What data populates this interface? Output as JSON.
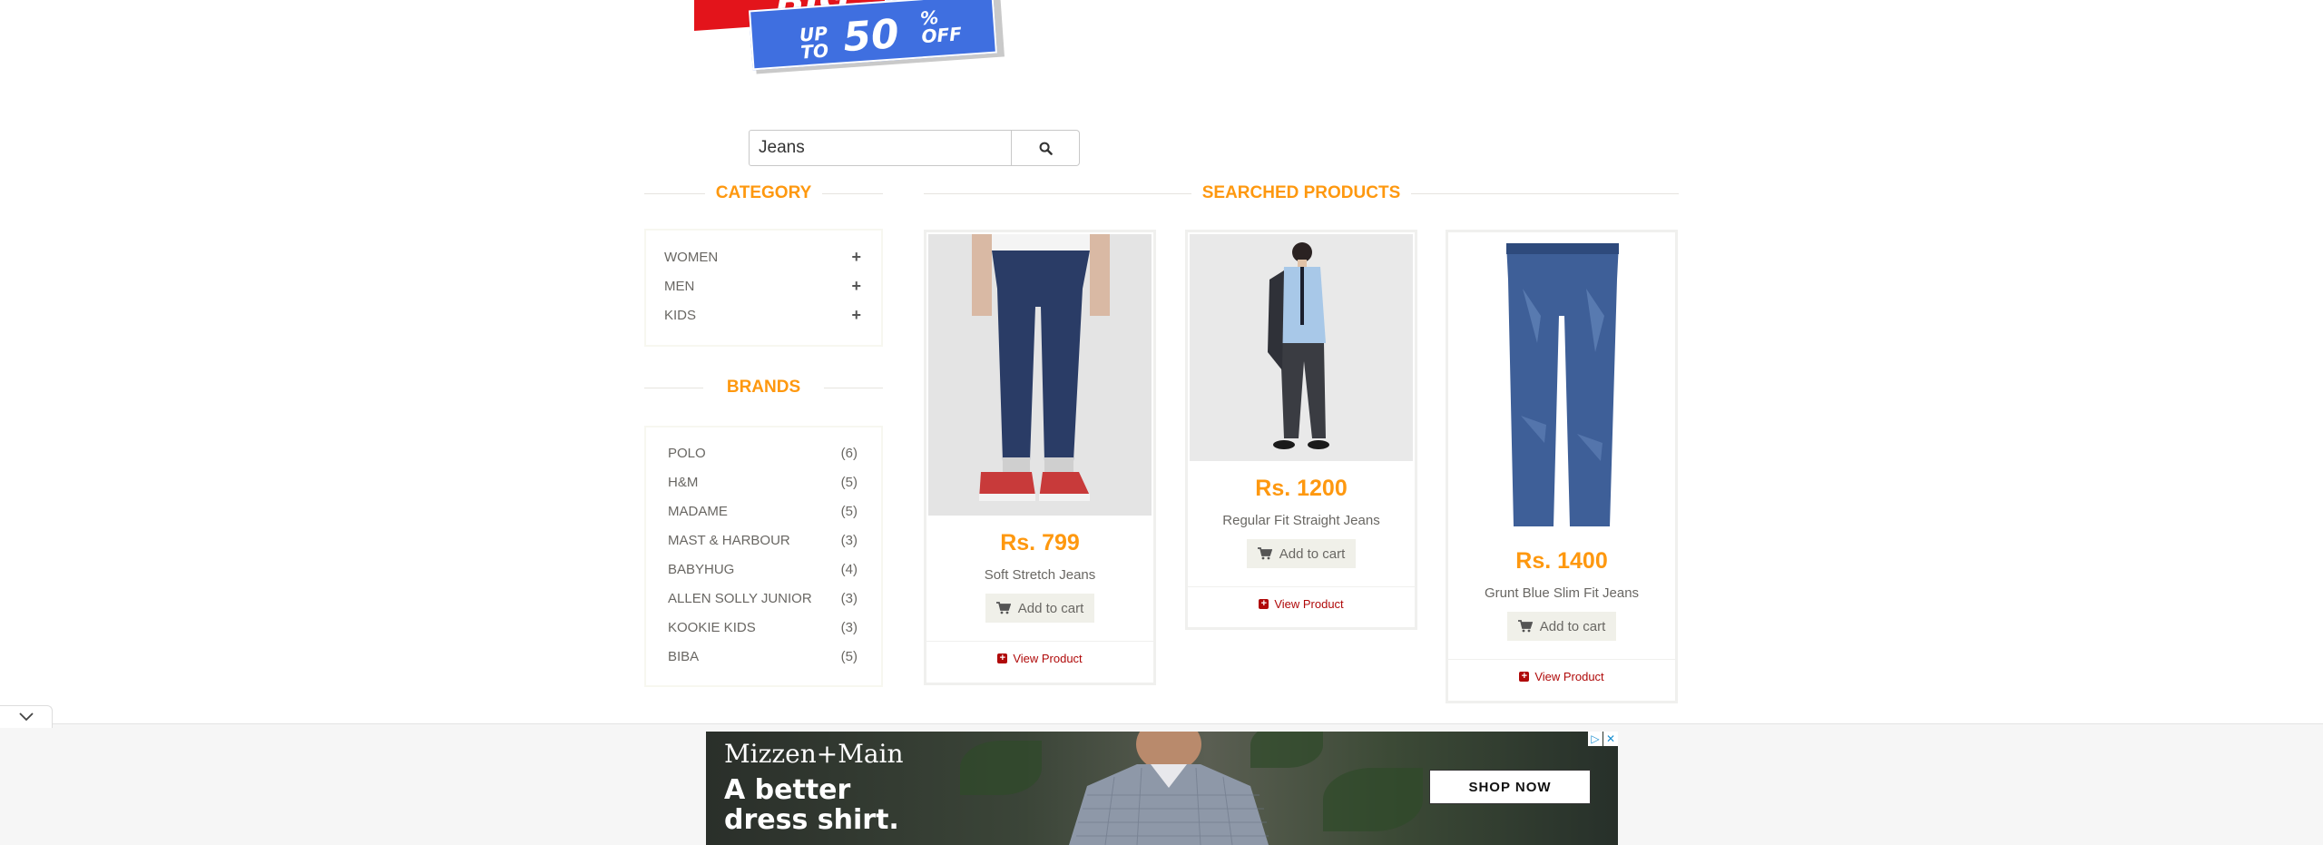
{
  "banner": {
    "big_text": "BIG",
    "upto": "UP TO",
    "discount": "50",
    "percent_off": "% OFF"
  },
  "search": {
    "value": "Jeans",
    "icon": "search-icon"
  },
  "sidebar": {
    "category_title": "CATEGORY",
    "categories": [
      {
        "label": "WOMEN",
        "icon": "plus-icon"
      },
      {
        "label": "MEN",
        "icon": "plus-icon"
      },
      {
        "label": "KIDS",
        "icon": "plus-icon"
      }
    ],
    "brands_title": "BRANDS",
    "brands": [
      {
        "label": "POLO",
        "count": "(6)"
      },
      {
        "label": "H&M",
        "count": "(5)"
      },
      {
        "label": "MADAME",
        "count": "(5)"
      },
      {
        "label": "MAST & HARBOUR",
        "count": "(3)"
      },
      {
        "label": "BABYHUG",
        "count": "(4)"
      },
      {
        "label": "ALLEN SOLLY JUNIOR",
        "count": "(3)"
      },
      {
        "label": "KOOKIE KIDS",
        "count": "(3)"
      },
      {
        "label": "BIBA",
        "count": "(5)"
      }
    ]
  },
  "main": {
    "title": "SEARCHED PRODUCTS",
    "products": [
      {
        "price": "Rs. 799",
        "name": "Soft Stretch Jeans",
        "add_to_cart": "Add to cart",
        "view": "View Product"
      },
      {
        "price": "Rs. 1200",
        "name": "Regular Fit Straight Jeans",
        "add_to_cart": "Add to cart",
        "view": "View Product"
      },
      {
        "price": "Rs. 1400",
        "name": "Grunt Blue Slim Fit Jeans",
        "add_to_cart": "Add to cart",
        "view": "View Product"
      }
    ]
  },
  "ad": {
    "brand": "Mizzen+Main",
    "tagline_1": "A better",
    "tagline_2": "dress shirt.",
    "cta": "SHOP NOW"
  },
  "colors": {
    "accent": "#fe980f",
    "link_red": "#b00a0a",
    "text": "#696763"
  }
}
